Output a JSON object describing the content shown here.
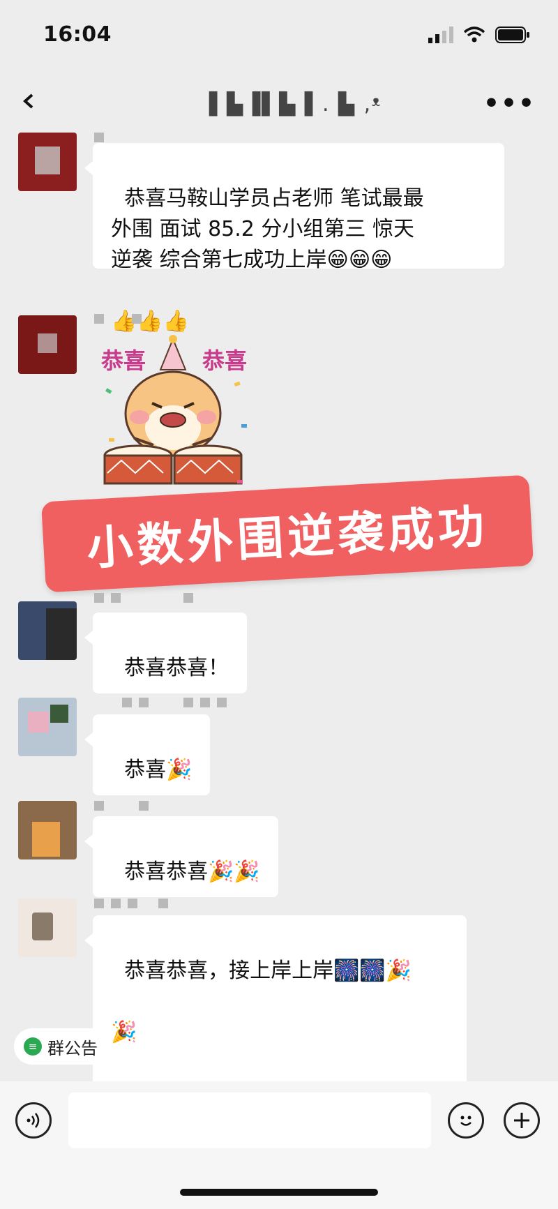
{
  "status_bar": {
    "time": "16:04"
  },
  "header": {
    "title": "▌▙▐▌▙ ▌. ▙ ,ᵜ",
    "more_label": "•••"
  },
  "messages": [
    {
      "text": "恭喜马鞍山学员占老师 笔试最最\n外围 面试 85.2 分小组第三 惊天\n逆袭 综合第七成功上岸",
      "emoji_line1": "😁😁😁",
      "emoji_line2": "👍👍👍"
    },
    {
      "sticker_left": "恭喜",
      "sticker_right": "恭喜"
    },
    {
      "text": "恭喜恭喜！"
    },
    {
      "text": "恭喜",
      "emoji": "🎉"
    },
    {
      "text": "恭喜恭喜",
      "emoji": "🎉🎉"
    },
    {
      "text": "恭喜恭喜，接上岸上岸",
      "emoji_line1": "🎆🎆🎉",
      "emoji_line2": "🎉"
    }
  ],
  "banner": {
    "text": "小数外围逆袭成功"
  },
  "group_notice": {
    "label": "群公告"
  },
  "input_bar": {
    "voice_icon": "voice-icon",
    "emoji_icon": "emoji-icon",
    "plus_icon": "plus-icon"
  }
}
